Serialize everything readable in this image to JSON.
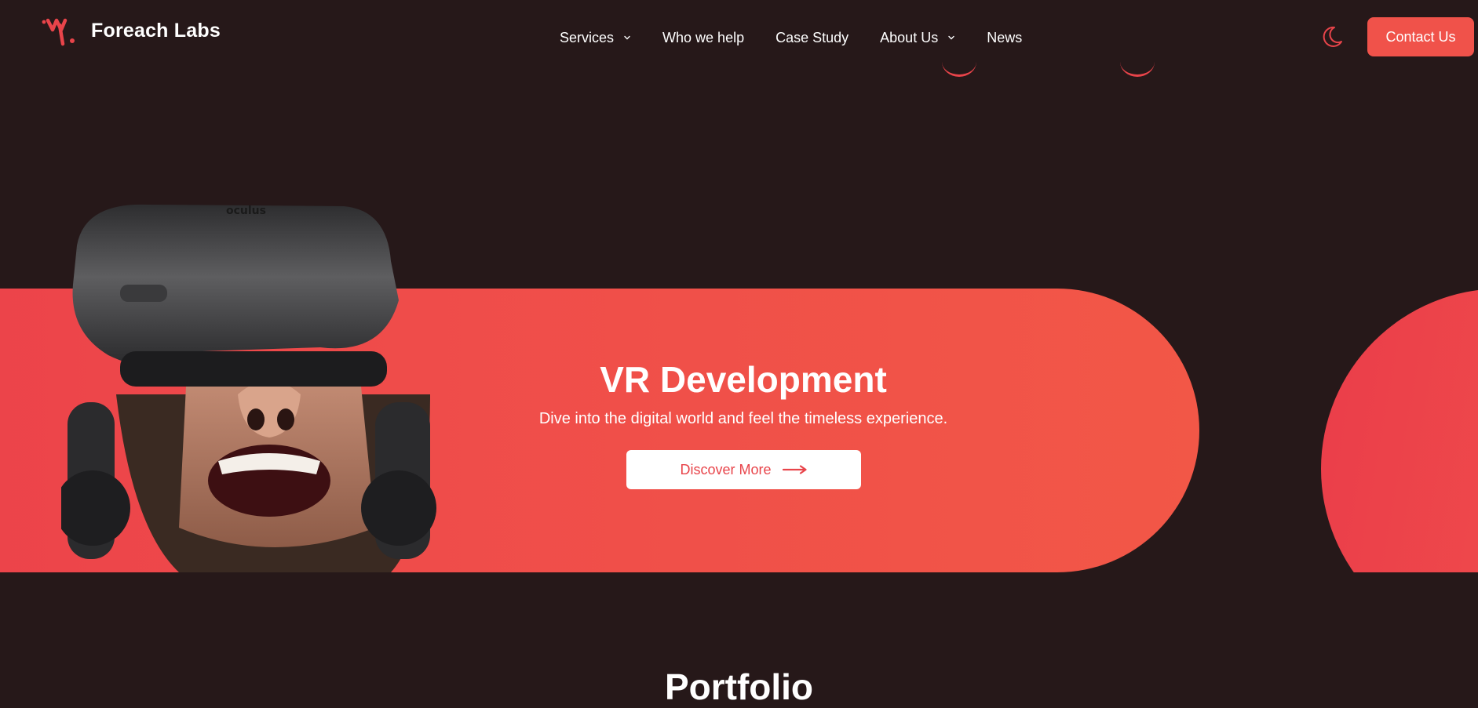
{
  "header": {
    "logo_text": "Foreach Labs",
    "nav": [
      {
        "label": "Services",
        "has_dropdown": true
      },
      {
        "label": "Who we help",
        "has_dropdown": false
      },
      {
        "label": "Case Study",
        "has_dropdown": false
      },
      {
        "label": "About Us",
        "has_dropdown": true
      },
      {
        "label": "News",
        "has_dropdown": false
      }
    ],
    "theme_icon": "moon-icon",
    "contact_label": "Contact Us"
  },
  "hero": {
    "title": "VR Development",
    "subtitle": "Dive into the digital world and feel the timeless experience.",
    "cta_label": "Discover More",
    "headset_brand_text": "oculus"
  },
  "portfolio": {
    "title": "Portfolio"
  },
  "colors": {
    "background": "#261819",
    "accent": "#f0524a",
    "text": "#ffffff"
  }
}
